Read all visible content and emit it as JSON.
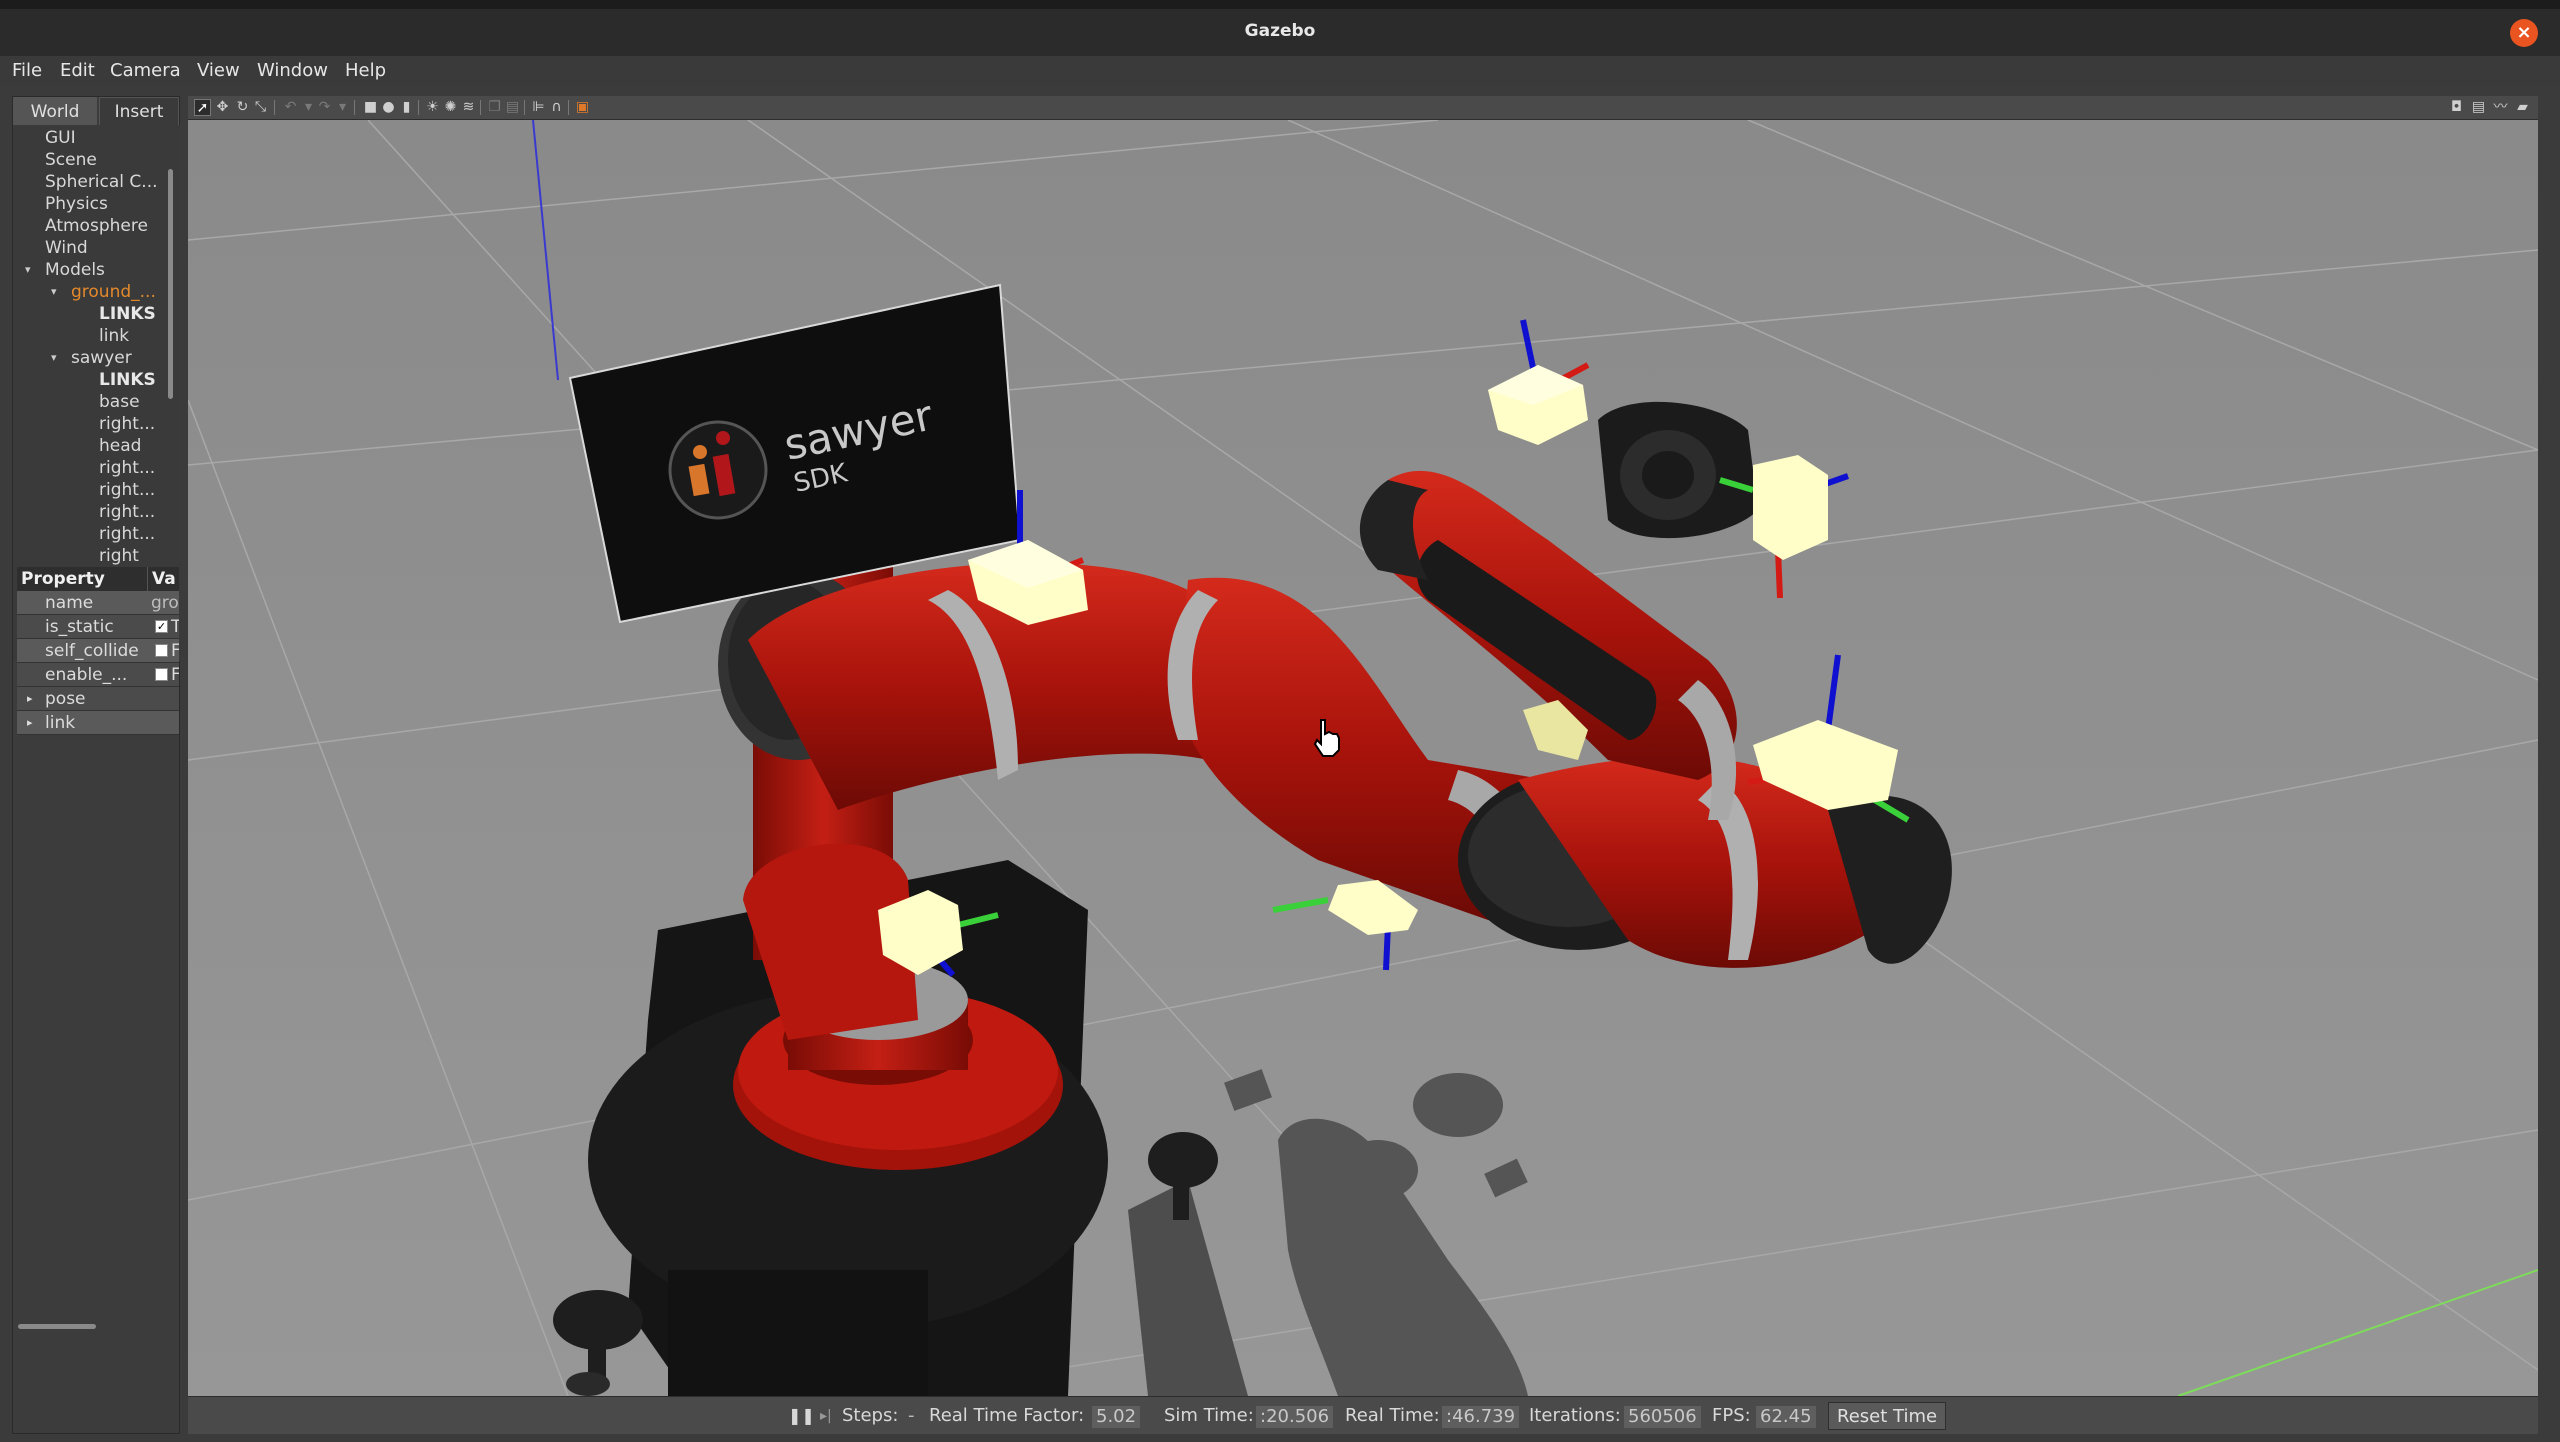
{
  "window": {
    "title": "Gazebo"
  },
  "menu": [
    "File",
    "Edit",
    "Camera",
    "View",
    "Window",
    "Help"
  ],
  "left_panel": {
    "tabs": [
      "World",
      "Insert"
    ],
    "tree": [
      {
        "label": "GUI",
        "level": 0
      },
      {
        "label": "Scene",
        "level": 0
      },
      {
        "label": "Spherical C...",
        "level": 0
      },
      {
        "label": "Physics",
        "level": 0
      },
      {
        "label": "Atmosphere",
        "level": 0
      },
      {
        "label": "Wind",
        "level": 0
      },
      {
        "label": "Models",
        "level": 0,
        "expanded": true
      },
      {
        "label": "ground_...",
        "level": 1,
        "expanded": true,
        "highlight": true
      },
      {
        "label": "LINKS",
        "level": 2,
        "bold": true
      },
      {
        "label": "link",
        "level": 2
      },
      {
        "label": "sawyer",
        "level": 1,
        "expanded": true
      },
      {
        "label": "LINKS",
        "level": 2,
        "bold": true
      },
      {
        "label": "base",
        "level": 2
      },
      {
        "label": "right...",
        "level": 2
      },
      {
        "label": "head",
        "level": 2
      },
      {
        "label": "right...",
        "level": 2
      },
      {
        "label": "right...",
        "level": 2
      },
      {
        "label": "right...",
        "level": 2
      },
      {
        "label": "right...",
        "level": 2
      },
      {
        "label": "right",
        "level": 2
      }
    ],
    "properties": {
      "header_property": "Property",
      "header_value": "Va",
      "rows": [
        {
          "name": "name",
          "value": "gro"
        },
        {
          "name": "is_static",
          "value": "T",
          "checked": true
        },
        {
          "name": "self_collide",
          "value": "F",
          "checked": false
        },
        {
          "name": "enable_...",
          "value": "F",
          "checked": false
        },
        {
          "name": "pose",
          "expandable": true
        },
        {
          "name": "link",
          "expandable": true
        }
      ]
    }
  },
  "toolbar": {
    "tools": [
      "select-mode",
      "translate-mode",
      "rotate-mode",
      "scale-mode",
      "undo",
      "undo-history",
      "redo",
      "redo-history",
      "box-shape",
      "sphere-shape",
      "cylinder-shape",
      "point-light",
      "spot-light",
      "directional-light",
      "copy",
      "paste",
      "align",
      "snap",
      "change-view",
      "screenshot",
      "log",
      "plot",
      "video-record"
    ]
  },
  "viewport": {
    "sign_text": "sawyer",
    "sign_subtext": "SDK",
    "colors": {
      "robot_red": "#b3140c",
      "ground": "#8f8f8f",
      "sign": "#111111",
      "marker": "#fffec8"
    }
  },
  "status": {
    "pause_icon": "pause-icon",
    "step_icon": "step-icon",
    "steps_label": "Steps:",
    "steps_value": "-",
    "rtf_label": "Real Time Factor:",
    "rtf_value": "5.02",
    "sim_time_label": "Sim Time:",
    "sim_time_value": ":20.506",
    "real_time_label": "Real Time:",
    "real_time_value": ":46.739",
    "iterations_label": "Iterations:",
    "iterations_value": "560506",
    "fps_label": "FPS:",
    "fps_value": "62.45",
    "reset_label": "Reset Time"
  }
}
